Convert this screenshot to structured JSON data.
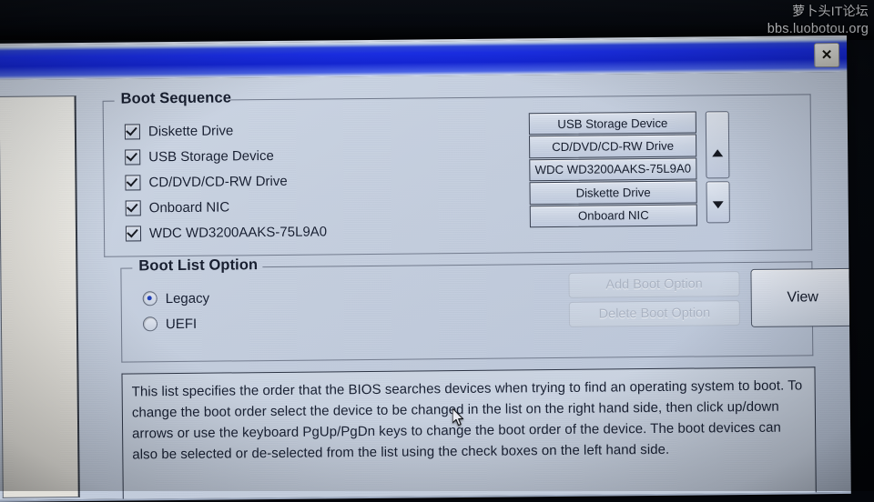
{
  "watermark": {
    "line1": "萝卜头IT论坛",
    "line2": "bbs.luobotou.org"
  },
  "window": {
    "title": "",
    "close_label": "✕"
  },
  "boot_sequence": {
    "legend": "Boot Sequence",
    "devices": [
      {
        "label": "Diskette Drive",
        "checked": true
      },
      {
        "label": "USB Storage Device",
        "checked": true
      },
      {
        "label": "CD/DVD/CD-RW Drive",
        "checked": true
      },
      {
        "label": "Onboard NIC",
        "checked": true
      },
      {
        "label": "WDC WD3200AAKS-75L9A0",
        "checked": true
      }
    ],
    "order": [
      "USB Storage Device",
      "CD/DVD/CD-RW Drive",
      "WDC WD3200AAKS-75L9A0",
      "Diskette Drive",
      "Onboard NIC"
    ],
    "scroll_up_icon": "arrow-up-icon",
    "scroll_down_icon": "arrow-down-icon"
  },
  "boot_list_option": {
    "legend": "Boot List Option",
    "options": [
      {
        "label": "Legacy",
        "selected": true
      },
      {
        "label": "UEFI",
        "selected": false
      }
    ]
  },
  "buttons": {
    "add_boot_option": {
      "label": "Add Boot Option",
      "enabled": false
    },
    "delete_boot_option": {
      "label": "Delete Boot Option",
      "enabled": false
    },
    "view": {
      "label": "View",
      "enabled": true
    }
  },
  "description": {
    "text": "This list specifies the order that the BIOS searches devices when trying to find an operating system to boot. To change the boot order select the device to be changed in the list on the right hand side, then click up/down arrows or use the keyboard PgUp/PgDn keys to change the boot order of the device. The boot devices can also be selected or de-selected from the list using the check boxes on the left hand side."
  },
  "colors": {
    "titlebar_blue": "#1b2fe8",
    "dialog_background": "#c5cfdf",
    "radio_accent": "#1b3bb8",
    "text": "#121a2e",
    "disabled_text": "#aab3c3"
  }
}
